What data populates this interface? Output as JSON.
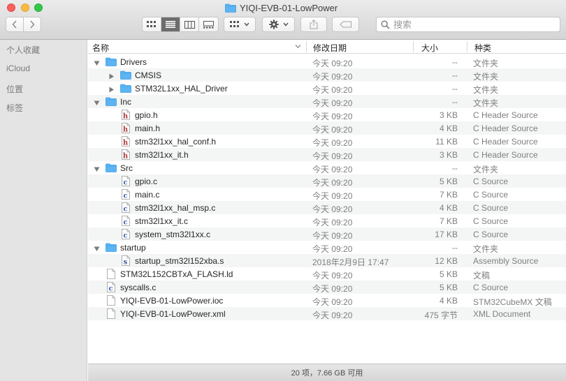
{
  "window": {
    "title": "YIQI-EVB-01-LowPower"
  },
  "toolbar": {
    "nav": {
      "back_icon": "chevron-left-icon",
      "forward_icon": "chevron-right-icon"
    },
    "views": [
      {
        "name": "icon-view",
        "icon": "grid-icon",
        "active": false
      },
      {
        "name": "list-view",
        "icon": "list-icon",
        "active": true
      },
      {
        "name": "column-view",
        "icon": "columns-icon",
        "active": false
      },
      {
        "name": "gallery-view",
        "icon": "gallery-icon",
        "active": false
      }
    ],
    "group_icon": "group-grid-icon",
    "action_icon": "gear-icon",
    "share_icon": "share-icon",
    "tag_icon": "tag-icon",
    "search": {
      "placeholder": "搜索",
      "value": ""
    }
  },
  "sidebar": {
    "items": [
      {
        "label": "个人收藏"
      },
      {
        "label": "iCloud"
      },
      {
        "label": "位置"
      },
      {
        "label": "标签"
      }
    ]
  },
  "columns": {
    "name": "名称",
    "date": "修改日期",
    "size": "大小",
    "kind": "种类"
  },
  "files": [
    {
      "name": "Drivers",
      "date": "今天 09:20",
      "size": "--",
      "kind": "文件夹",
      "type": "folder",
      "level": 0,
      "disclosure": "open"
    },
    {
      "name": "CMSIS",
      "date": "今天 09:20",
      "size": "--",
      "kind": "文件夹",
      "type": "folder",
      "level": 1,
      "disclosure": "closed"
    },
    {
      "name": "STM32L1xx_HAL_Driver",
      "date": "今天 09:20",
      "size": "--",
      "kind": "文件夹",
      "type": "folder",
      "level": 1,
      "disclosure": "closed"
    },
    {
      "name": "Inc",
      "date": "今天 09:20",
      "size": "--",
      "kind": "文件夹",
      "type": "folder",
      "level": 0,
      "disclosure": "open"
    },
    {
      "name": "gpio.h",
      "date": "今天 09:20",
      "size": "3 KB",
      "kind": "C Header Source",
      "type": "h",
      "level": 1,
      "disclosure": "none"
    },
    {
      "name": "main.h",
      "date": "今天 09:20",
      "size": "4 KB",
      "kind": "C Header Source",
      "type": "h",
      "level": 1,
      "disclosure": "none"
    },
    {
      "name": "stm32l1xx_hal_conf.h",
      "date": "今天 09:20",
      "size": "11 KB",
      "kind": "C Header Source",
      "type": "h",
      "level": 1,
      "disclosure": "none"
    },
    {
      "name": "stm32l1xx_it.h",
      "date": "今天 09:20",
      "size": "3 KB",
      "kind": "C Header Source",
      "type": "h",
      "level": 1,
      "disclosure": "none"
    },
    {
      "name": "Src",
      "date": "今天 09:20",
      "size": "--",
      "kind": "文件夹",
      "type": "folder",
      "level": 0,
      "disclosure": "open"
    },
    {
      "name": "gpio.c",
      "date": "今天 09:20",
      "size": "5 KB",
      "kind": "C Source",
      "type": "c",
      "level": 1,
      "disclosure": "none"
    },
    {
      "name": "main.c",
      "date": "今天 09:20",
      "size": "7 KB",
      "kind": "C Source",
      "type": "c",
      "level": 1,
      "disclosure": "none"
    },
    {
      "name": "stm32l1xx_hal_msp.c",
      "date": "今天 09:20",
      "size": "4 KB",
      "kind": "C Source",
      "type": "c",
      "level": 1,
      "disclosure": "none"
    },
    {
      "name": "stm32l1xx_it.c",
      "date": "今天 09:20",
      "size": "7 KB",
      "kind": "C Source",
      "type": "c",
      "level": 1,
      "disclosure": "none"
    },
    {
      "name": "system_stm32l1xx.c",
      "date": "今天 09:20",
      "size": "17 KB",
      "kind": "C Source",
      "type": "c",
      "level": 1,
      "disclosure": "none"
    },
    {
      "name": "startup",
      "date": "今天 09:20",
      "size": "--",
      "kind": "文件夹",
      "type": "folder",
      "level": 0,
      "disclosure": "open"
    },
    {
      "name": "startup_stm32l152xba.s",
      "date": "2018年2月9日 17:47",
      "size": "12 KB",
      "kind": "Assembly Source",
      "type": "s",
      "level": 1,
      "disclosure": "none"
    },
    {
      "name": "STM32L152CBTxA_FLASH.ld",
      "date": "今天 09:20",
      "size": "5 KB",
      "kind": "文稿",
      "type": "doc",
      "level": 0,
      "disclosure": "none"
    },
    {
      "name": "syscalls.c",
      "date": "今天 09:20",
      "size": "5 KB",
      "kind": "C Source",
      "type": "c",
      "level": 0,
      "disclosure": "none"
    },
    {
      "name": "YIQI-EVB-01-LowPower.ioc",
      "date": "今天 09:20",
      "size": "4 KB",
      "kind": "STM32CubeMX 文稿",
      "type": "doc",
      "level": 0,
      "disclosure": "none"
    },
    {
      "name": "YIQI-EVB-01-LowPower.xml",
      "date": "今天 09:20",
      "size": "475 字节",
      "kind": "XML Document",
      "type": "doc",
      "level": 0,
      "disclosure": "none"
    }
  ],
  "status": {
    "text": "20 项，7.66 GB 可用"
  },
  "colors": {
    "folder": "#5cb5f2",
    "folder_dark": "#3d9de6",
    "h_letter": "#b03a3a",
    "c_letter": "#3a5fb0",
    "s_letter": "#3a4fa0"
  }
}
